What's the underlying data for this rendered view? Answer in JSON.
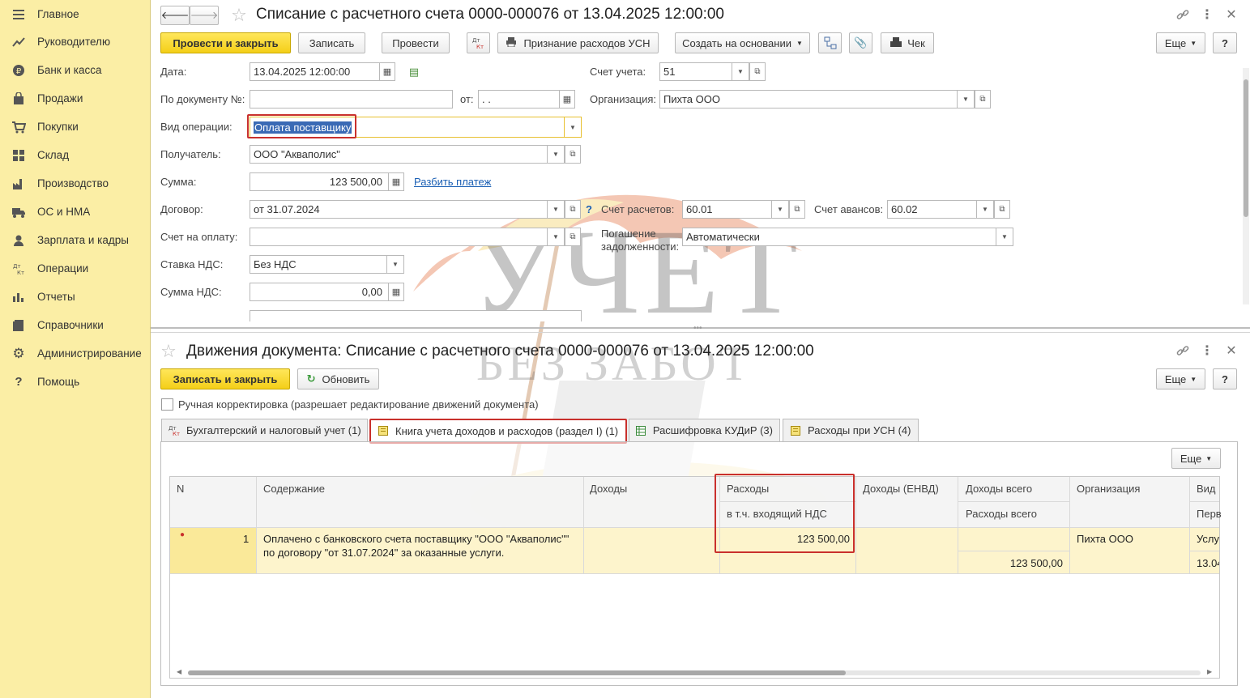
{
  "sidebar": {
    "items": [
      {
        "label": "Главное",
        "icon": "menu-icon"
      },
      {
        "label": "Руководителю",
        "icon": "trend-icon"
      },
      {
        "label": "Банк и касса",
        "icon": "coin-icon"
      },
      {
        "label": "Продажи",
        "icon": "bag-icon"
      },
      {
        "label": "Покупки",
        "icon": "cart-icon"
      },
      {
        "label": "Склад",
        "icon": "grid-icon"
      },
      {
        "label": "Производство",
        "icon": "factory-icon"
      },
      {
        "label": "ОС и НМА",
        "icon": "truck-icon"
      },
      {
        "label": "Зарплата и кадры",
        "icon": "person-icon"
      },
      {
        "label": "Операции",
        "icon": "dtkt-icon"
      },
      {
        "label": "Отчеты",
        "icon": "bar-chart-icon"
      },
      {
        "label": "Справочники",
        "icon": "book-icon"
      },
      {
        "label": "Администрирование",
        "icon": "gear-icon"
      },
      {
        "label": "Помощь",
        "icon": "question-icon"
      }
    ]
  },
  "doc": {
    "title": "Списание с расчетного счета 0000-000076 от 13.04.2025 12:00:00",
    "toolbar": {
      "post_close": "Провести и закрыть",
      "save": "Записать",
      "post": "Провести",
      "usn": "Признание расходов УСН",
      "create_based": "Создать на основании",
      "check": "Чек",
      "more": "Еще",
      "help": "?"
    },
    "fields": {
      "date_label": "Дата:",
      "date_value": "13.04.2025 12:00:00",
      "account_label": "Счет учета:",
      "account_value": "51",
      "doc_no_label": "По документу №:",
      "doc_no_value": "",
      "from_label": "от:",
      "from_value": " .  .",
      "org_label": "Организация:",
      "org_value": "Пихта ООО",
      "op_label": "Вид операции:",
      "op_value": "Оплата поставщику",
      "recipient_label": "Получатель:",
      "recipient_value": "ООО \"Акваполис\"",
      "sum_label": "Сумма:",
      "sum_value": "123 500,00",
      "split_link": "Разбить платеж",
      "contract_label": "Договор:",
      "contract_value": "от 31.07.2024",
      "settle_label": "Счет расчетов:",
      "settle_value": "60.01",
      "advance_label": "Счет авансов:",
      "advance_value": "60.02",
      "invoice_label": "Счет на оплату:",
      "invoice_value": "",
      "repay_label_1": "Погашение",
      "repay_label_2": "задолженности:",
      "repay_value": "Автоматически",
      "vat_rate_label": "Ставка НДС:",
      "vat_rate_value": "Без НДС",
      "vat_sum_label": "Сумма НДС:",
      "vat_sum_value": "0,00"
    }
  },
  "movements": {
    "title": "Движения документа: Списание с расчетного счета 0000-000076 от 13.04.2025 12:00:00",
    "save_close": "Записать и закрыть",
    "refresh": "Обновить",
    "more": "Еще",
    "help": "?",
    "manual_label": "Ручная корректировка (разрешает редактирование движений документа)",
    "tabs": [
      {
        "label": "Бухгалтерский и налоговый учет (1)"
      },
      {
        "label": "Книга учета доходов и расходов (раздел I) (1)"
      },
      {
        "label": "Расшифровка КУДиР (3)"
      },
      {
        "label": "Расходы при УСН (4)"
      }
    ],
    "table_more": "Еще",
    "columns": {
      "n": "N",
      "content": "Содержание",
      "income": "Доходы",
      "expenses": "Расходы",
      "expenses_vat": "в т.ч. входящий НДС",
      "income_envd": "Доходы (ЕНВД)",
      "income_total": "Доходы всего",
      "expenses_total": "Расходы всего",
      "org": "Организация",
      "type": "Вид",
      "type_sub": "Перв"
    },
    "row": {
      "n": "1",
      "content_1": "Оплачено с банковского счета поставщику \"ООО \"Акваполис\"\"",
      "content_2": "по договору \"от 31.07.2024\" за оказанные услуги.",
      "expenses": "123 500,00",
      "expenses_total": "123 500,00",
      "org": "Пихта ООО",
      "type": "Услу",
      "date": "13.04"
    }
  },
  "watermark": {
    "line1": "УЧЕТ",
    "line2": "БЕЗ ЗАБОТ"
  },
  "colors": {
    "accent_yellow": "#f4cf18",
    "sidebar_bg": "#fbeea5",
    "highlight_red": "#c9302c",
    "row_bg": "#fdf3c8",
    "link_blue": "#1a5fb4"
  }
}
